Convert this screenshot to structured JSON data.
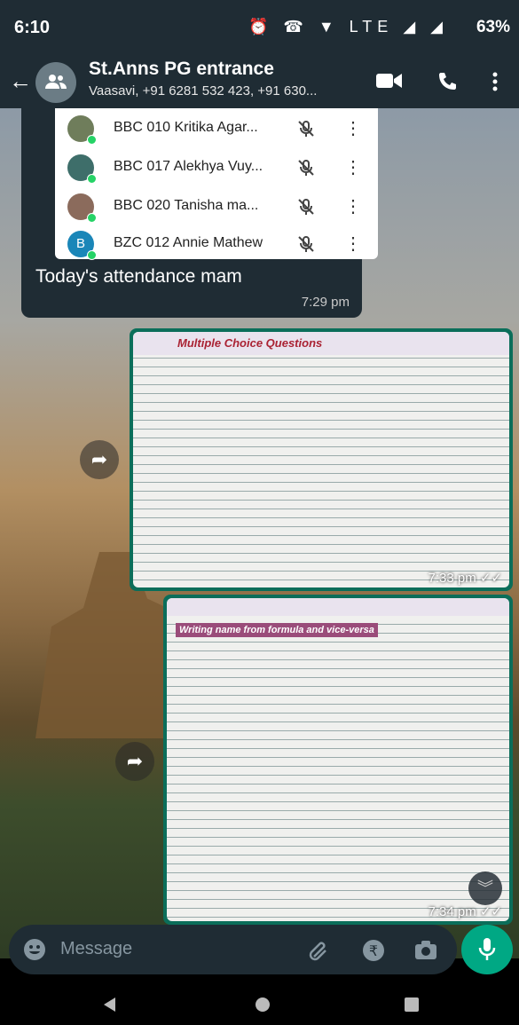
{
  "status_bar": {
    "time": "6:10",
    "battery": "63%",
    "icons": "⏰ ☎ ▼ LTE ◢ ◢"
  },
  "header": {
    "title": "St.Anns PG entrance",
    "subtitle": "Vaasavi, +91 6281 532 423, +91 630..."
  },
  "message1": {
    "participants": [
      {
        "name": "BBC 010 Kritika Agar...",
        "avatar_color": "#6f7d5b"
      },
      {
        "name": "BBC 017 Alekhya Vuy...",
        "avatar_color": "#3e6e6a"
      },
      {
        "name": "BBC 020 Tanisha ma...",
        "avatar_color": "#8b6b5c"
      },
      {
        "name": "BZC 012 Annie Mathew",
        "avatar_color": "#1a86b8",
        "initial": "B"
      }
    ],
    "text": "Today's attendance mam",
    "time": "7:29 pm"
  },
  "message2": {
    "page_heading": "Multiple Choice Questions",
    "time": "7:33 pm ✓✓"
  },
  "message3": {
    "page_heading": "Writing name from formula and vice-versa",
    "time": "7:34 pm ✓✓"
  },
  "composer": {
    "placeholder": "Message"
  },
  "colors": {
    "header_bg": "#1f2c34",
    "accent": "#00a884",
    "image_border": "#0b6e5a"
  }
}
